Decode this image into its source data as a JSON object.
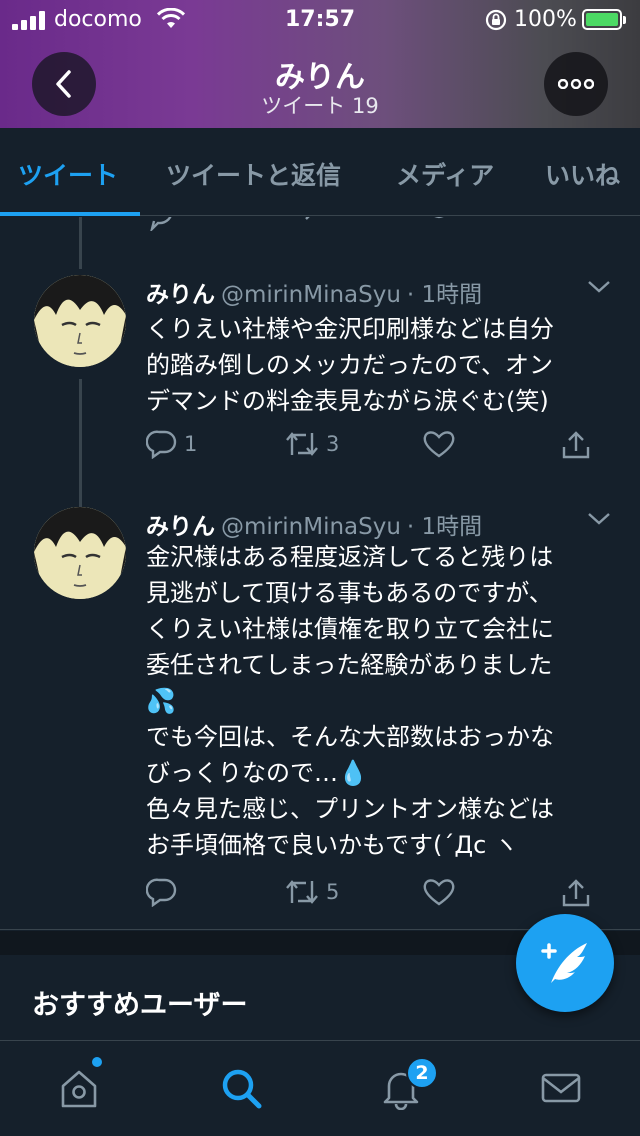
{
  "status_bar": {
    "carrier": "docomo",
    "time": "17:57",
    "battery": "100%"
  },
  "header": {
    "name": "みりん",
    "tweet_count": "ツイート 19"
  },
  "tabs": [
    {
      "label": "ツイート",
      "active": true
    },
    {
      "label": "ツイートと返信",
      "active": false
    },
    {
      "label": "メディア",
      "active": false
    },
    {
      "label": "いいね",
      "active": false
    }
  ],
  "tweets": [
    {
      "name": "みりん",
      "handle": "@mirinMinaSyu",
      "time": "· 1時間",
      "lines": [
        "くりえい社様や金沢印刷様などは自分",
        "的踏み倒しのメッカだったので、オン",
        "デマンドの料金表見ながら涙ぐむ(笑)"
      ],
      "replies": "1",
      "retweets": "3",
      "likes": ""
    },
    {
      "name": "みりん",
      "handle": "@mirinMinaSyu",
      "time": "· 1時間",
      "lines": [
        "金沢様はある程度返済してると残りは",
        "見逃がして頂ける事もあるのですが、",
        "くりえい社様は債権を取り立て会社に",
        "委任されてしまった経験がありました",
        "💦",
        "でも今回は、そんな大部数はおっかな",
        "びっくりなので…💧",
        "色々見た感じ、プリントオン様などは",
        "お手頃価格で良いかもです(´Дc ヽ"
      ],
      "replies": "",
      "retweets": "5",
      "likes": ""
    }
  ],
  "recommend": {
    "title": "おすすめユーザー"
  },
  "bottom_nav": {
    "items": [
      "home",
      "search",
      "notifications",
      "messages"
    ],
    "notification_badge": "2"
  },
  "colors": {
    "accent": "#1da1f2",
    "background": "#15202b",
    "muted": "#8899a6",
    "border": "#38444d"
  }
}
